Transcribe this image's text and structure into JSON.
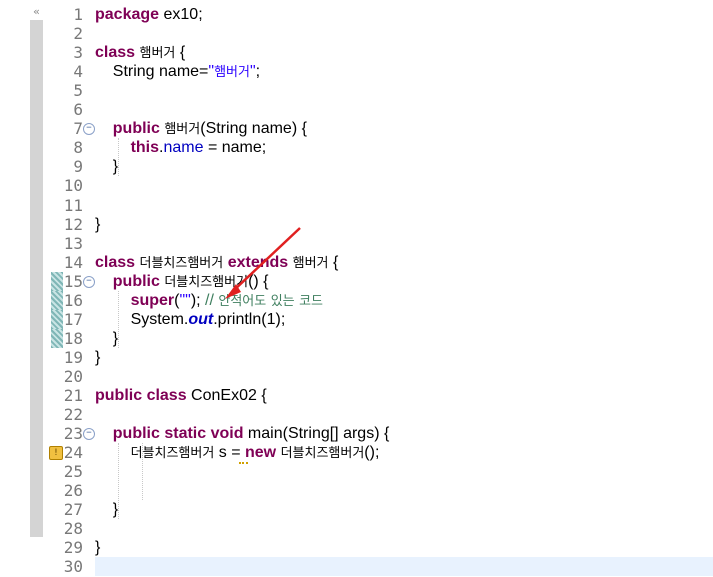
{
  "editor": {
    "collapse_glyph": "«",
    "lines": [
      {
        "n": "1",
        "t": "package ex10;"
      },
      {
        "n": "2",
        "t": ""
      },
      {
        "n": "3",
        "t": "class 햄버거 {"
      },
      {
        "n": "4",
        "t": "    String name=\"햄버거\";"
      },
      {
        "n": "5",
        "t": ""
      },
      {
        "n": "6",
        "t": ""
      },
      {
        "n": "7",
        "t": "    public 햄버거(String name) {"
      },
      {
        "n": "8",
        "t": "        this.name = name;"
      },
      {
        "n": "9",
        "t": "    }"
      },
      {
        "n": "10",
        "t": ""
      },
      {
        "n": "11",
        "t": ""
      },
      {
        "n": "12",
        "t": "}"
      },
      {
        "n": "13",
        "t": ""
      },
      {
        "n": "14",
        "t": "class 더블치즈햄버거 extends 햄버거 {"
      },
      {
        "n": "15",
        "t": "    public 더블치즈햄버거() {"
      },
      {
        "n": "16",
        "t": "        super(\"\"); // 안적어도 있는 코드"
      },
      {
        "n": "17",
        "t": "        System.out.println(1);"
      },
      {
        "n": "18",
        "t": "    }"
      },
      {
        "n": "19",
        "t": "}"
      },
      {
        "n": "20",
        "t": ""
      },
      {
        "n": "21",
        "t": "public class ConEx02 {"
      },
      {
        "n": "22",
        "t": ""
      },
      {
        "n": "23",
        "t": "    public static void main(String[] args) {"
      },
      {
        "n": "24",
        "t": "        더블치즈햄버거 s = new 더블치즈햄버거();"
      },
      {
        "n": "25",
        "t": ""
      },
      {
        "n": "26",
        "t": ""
      },
      {
        "n": "27",
        "t": "    }"
      },
      {
        "n": "28",
        "t": ""
      },
      {
        "n": "29",
        "t": "}"
      },
      {
        "n": "30",
        "t": ""
      }
    ],
    "fold_glyph": "⊖",
    "warning_glyph": "!",
    "colors": {
      "keyword": "#7f0055",
      "string": "#2a00ff",
      "field": "#0000c0",
      "comment": "#3f7f5f",
      "annotation_arrow": "#e02020"
    }
  }
}
